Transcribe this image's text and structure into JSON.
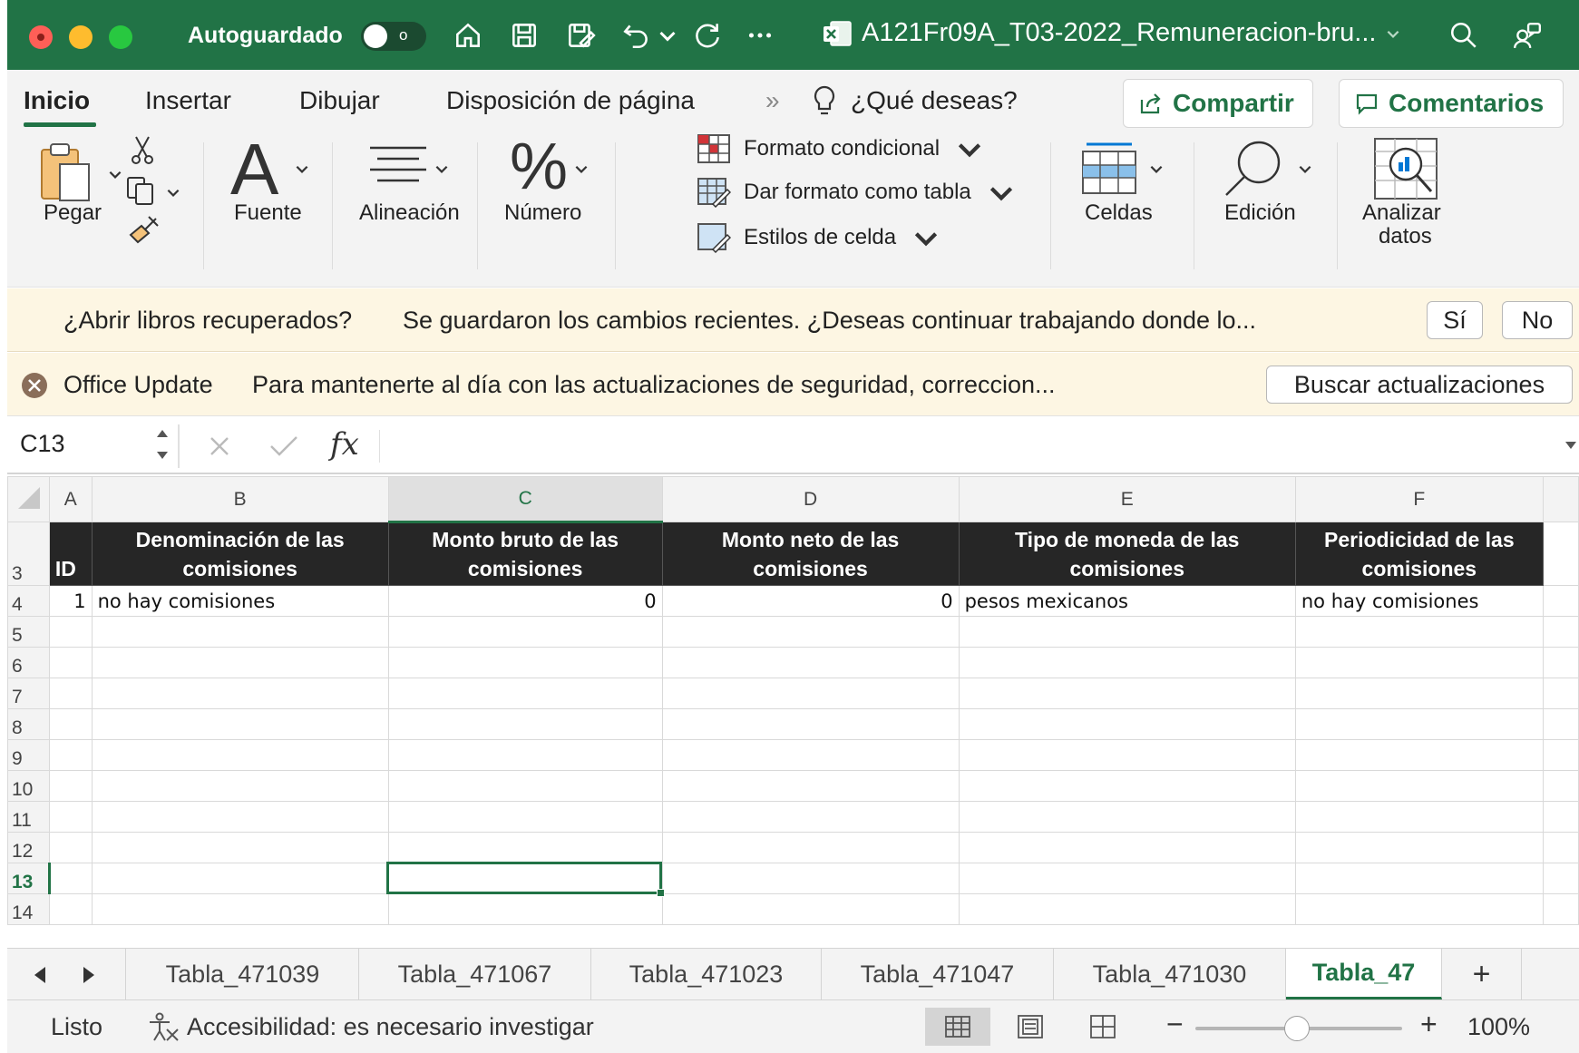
{
  "titlebar": {
    "autosave_label": "Autoguardado",
    "autosave_state": "o",
    "filename": "A121Fr09A_T03-2022_Remuneracion-bru...",
    "accent": "#217346"
  },
  "ribbon_tabs": {
    "items": [
      "Inicio",
      "Insertar",
      "Dibujar",
      "Disposición de página"
    ],
    "active": "Inicio",
    "more": "»",
    "tell_me": "¿Qué deseas?",
    "share": "Compartir",
    "comments": "Comentarios"
  },
  "ribbon": {
    "paste": "Pegar",
    "font": "Fuente",
    "alignment": "Alineación",
    "number": "Número",
    "conditional_format": "Formato condicional",
    "format_as_table": "Dar formato como tabla",
    "cell_styles": "Estilos de celda",
    "cells": "Celdas",
    "editing": "Edición",
    "analyze_line1": "Analizar",
    "analyze_line2": "datos",
    "font_glyph": "A",
    "number_glyph": "%"
  },
  "banners": {
    "recovered_bold": "¿Abrir libros recuperados?",
    "recovered_text": "Se guardaron los cambios recientes. ¿Deseas continuar trabajando donde lo...",
    "yes": "Sí",
    "no": "No",
    "update_bold": "Office Update",
    "update_text": "Para mantenerte al día con las actualizaciones de seguridad, correccion...",
    "update_button": "Buscar actualizaciones"
  },
  "formula_bar": {
    "name_box": "C13",
    "fx": "fx",
    "value": ""
  },
  "sheet": {
    "columns": [
      "A",
      "B",
      "C",
      "D",
      "E",
      "F"
    ],
    "selected_column": "C",
    "selected_row": "13",
    "header_row_number": "3",
    "headers": [
      "ID",
      "Denominación de las comisiones",
      "Monto bruto de las comisiones",
      "Monto neto de las comisiones",
      "Tipo de moneda de las comisiones",
      "Periodicidad de las comisiones"
    ],
    "data_row_number": "4",
    "data": [
      "1",
      "no hay comisiones",
      "0",
      "0",
      "pesos mexicanos",
      "no hay comisiones"
    ],
    "empty_rows": [
      "5",
      "6",
      "7",
      "8",
      "9",
      "10",
      "11",
      "12",
      "13",
      "14"
    ]
  },
  "sheet_tabs": {
    "items": [
      "Tabla_471039",
      "Tabla_471067",
      "Tabla_471023",
      "Tabla_471047",
      "Tabla_471030",
      "Tabla_47"
    ],
    "active_index": 5,
    "add": "+"
  },
  "statusbar": {
    "ready": "Listo",
    "accessibility": "Accesibilidad: es necesario investigar",
    "zoom_minus": "−",
    "zoom_plus": "+",
    "zoom": "100%",
    "zoom_level_percent": 100
  }
}
